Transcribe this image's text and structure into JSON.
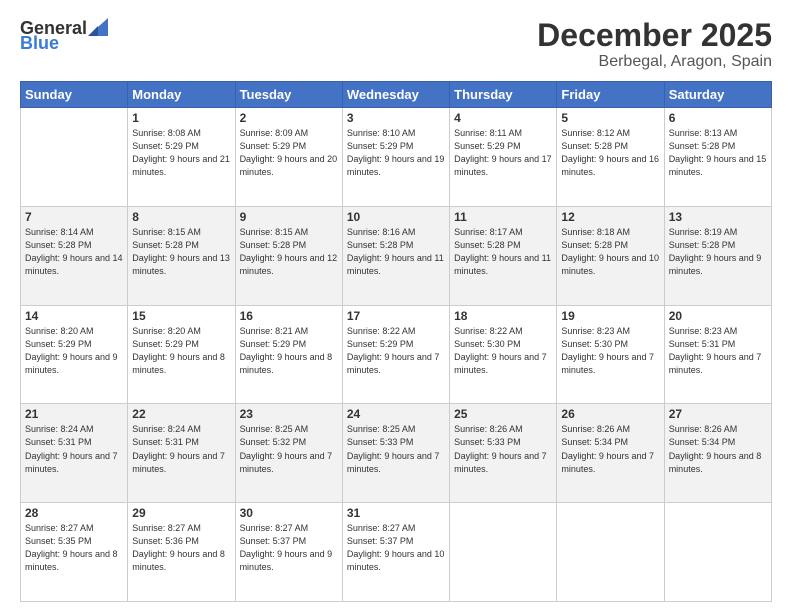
{
  "header": {
    "logo_general": "General",
    "logo_blue": "Blue",
    "title": "December 2025",
    "subtitle": "Berbegal, Aragon, Spain"
  },
  "weekdays": [
    "Sunday",
    "Monday",
    "Tuesday",
    "Wednesday",
    "Thursday",
    "Friday",
    "Saturday"
  ],
  "weeks": [
    [
      {
        "day": "",
        "sunrise": "",
        "sunset": "",
        "daylight": ""
      },
      {
        "day": "1",
        "sunrise": "Sunrise: 8:08 AM",
        "sunset": "Sunset: 5:29 PM",
        "daylight": "Daylight: 9 hours and 21 minutes."
      },
      {
        "day": "2",
        "sunrise": "Sunrise: 8:09 AM",
        "sunset": "Sunset: 5:29 PM",
        "daylight": "Daylight: 9 hours and 20 minutes."
      },
      {
        "day": "3",
        "sunrise": "Sunrise: 8:10 AM",
        "sunset": "Sunset: 5:29 PM",
        "daylight": "Daylight: 9 hours and 19 minutes."
      },
      {
        "day": "4",
        "sunrise": "Sunrise: 8:11 AM",
        "sunset": "Sunset: 5:29 PM",
        "daylight": "Daylight: 9 hours and 17 minutes."
      },
      {
        "day": "5",
        "sunrise": "Sunrise: 8:12 AM",
        "sunset": "Sunset: 5:28 PM",
        "daylight": "Daylight: 9 hours and 16 minutes."
      },
      {
        "day": "6",
        "sunrise": "Sunrise: 8:13 AM",
        "sunset": "Sunset: 5:28 PM",
        "daylight": "Daylight: 9 hours and 15 minutes."
      }
    ],
    [
      {
        "day": "7",
        "sunrise": "Sunrise: 8:14 AM",
        "sunset": "Sunset: 5:28 PM",
        "daylight": "Daylight: 9 hours and 14 minutes."
      },
      {
        "day": "8",
        "sunrise": "Sunrise: 8:15 AM",
        "sunset": "Sunset: 5:28 PM",
        "daylight": "Daylight: 9 hours and 13 minutes."
      },
      {
        "day": "9",
        "sunrise": "Sunrise: 8:15 AM",
        "sunset": "Sunset: 5:28 PM",
        "daylight": "Daylight: 9 hours and 12 minutes."
      },
      {
        "day": "10",
        "sunrise": "Sunrise: 8:16 AM",
        "sunset": "Sunset: 5:28 PM",
        "daylight": "Daylight: 9 hours and 11 minutes."
      },
      {
        "day": "11",
        "sunrise": "Sunrise: 8:17 AM",
        "sunset": "Sunset: 5:28 PM",
        "daylight": "Daylight: 9 hours and 11 minutes."
      },
      {
        "day": "12",
        "sunrise": "Sunrise: 8:18 AM",
        "sunset": "Sunset: 5:28 PM",
        "daylight": "Daylight: 9 hours and 10 minutes."
      },
      {
        "day": "13",
        "sunrise": "Sunrise: 8:19 AM",
        "sunset": "Sunset: 5:28 PM",
        "daylight": "Daylight: 9 hours and 9 minutes."
      }
    ],
    [
      {
        "day": "14",
        "sunrise": "Sunrise: 8:20 AM",
        "sunset": "Sunset: 5:29 PM",
        "daylight": "Daylight: 9 hours and 9 minutes."
      },
      {
        "day": "15",
        "sunrise": "Sunrise: 8:20 AM",
        "sunset": "Sunset: 5:29 PM",
        "daylight": "Daylight: 9 hours and 8 minutes."
      },
      {
        "day": "16",
        "sunrise": "Sunrise: 8:21 AM",
        "sunset": "Sunset: 5:29 PM",
        "daylight": "Daylight: 9 hours and 8 minutes."
      },
      {
        "day": "17",
        "sunrise": "Sunrise: 8:22 AM",
        "sunset": "Sunset: 5:29 PM",
        "daylight": "Daylight: 9 hours and 7 minutes."
      },
      {
        "day": "18",
        "sunrise": "Sunrise: 8:22 AM",
        "sunset": "Sunset: 5:30 PM",
        "daylight": "Daylight: 9 hours and 7 minutes."
      },
      {
        "day": "19",
        "sunrise": "Sunrise: 8:23 AM",
        "sunset": "Sunset: 5:30 PM",
        "daylight": "Daylight: 9 hours and 7 minutes."
      },
      {
        "day": "20",
        "sunrise": "Sunrise: 8:23 AM",
        "sunset": "Sunset: 5:31 PM",
        "daylight": "Daylight: 9 hours and 7 minutes."
      }
    ],
    [
      {
        "day": "21",
        "sunrise": "Sunrise: 8:24 AM",
        "sunset": "Sunset: 5:31 PM",
        "daylight": "Daylight: 9 hours and 7 minutes."
      },
      {
        "day": "22",
        "sunrise": "Sunrise: 8:24 AM",
        "sunset": "Sunset: 5:31 PM",
        "daylight": "Daylight: 9 hours and 7 minutes."
      },
      {
        "day": "23",
        "sunrise": "Sunrise: 8:25 AM",
        "sunset": "Sunset: 5:32 PM",
        "daylight": "Daylight: 9 hours and 7 minutes."
      },
      {
        "day": "24",
        "sunrise": "Sunrise: 8:25 AM",
        "sunset": "Sunset: 5:33 PM",
        "daylight": "Daylight: 9 hours and 7 minutes."
      },
      {
        "day": "25",
        "sunrise": "Sunrise: 8:26 AM",
        "sunset": "Sunset: 5:33 PM",
        "daylight": "Daylight: 9 hours and 7 minutes."
      },
      {
        "day": "26",
        "sunrise": "Sunrise: 8:26 AM",
        "sunset": "Sunset: 5:34 PM",
        "daylight": "Daylight: 9 hours and 7 minutes."
      },
      {
        "day": "27",
        "sunrise": "Sunrise: 8:26 AM",
        "sunset": "Sunset: 5:34 PM",
        "daylight": "Daylight: 9 hours and 8 minutes."
      }
    ],
    [
      {
        "day": "28",
        "sunrise": "Sunrise: 8:27 AM",
        "sunset": "Sunset: 5:35 PM",
        "daylight": "Daylight: 9 hours and 8 minutes."
      },
      {
        "day": "29",
        "sunrise": "Sunrise: 8:27 AM",
        "sunset": "Sunset: 5:36 PM",
        "daylight": "Daylight: 9 hours and 8 minutes."
      },
      {
        "day": "30",
        "sunrise": "Sunrise: 8:27 AM",
        "sunset": "Sunset: 5:37 PM",
        "daylight": "Daylight: 9 hours and 9 minutes."
      },
      {
        "day": "31",
        "sunrise": "Sunrise: 8:27 AM",
        "sunset": "Sunset: 5:37 PM",
        "daylight": "Daylight: 9 hours and 10 minutes."
      },
      {
        "day": "",
        "sunrise": "",
        "sunset": "",
        "daylight": ""
      },
      {
        "day": "",
        "sunrise": "",
        "sunset": "",
        "daylight": ""
      },
      {
        "day": "",
        "sunrise": "",
        "sunset": "",
        "daylight": ""
      }
    ]
  ]
}
